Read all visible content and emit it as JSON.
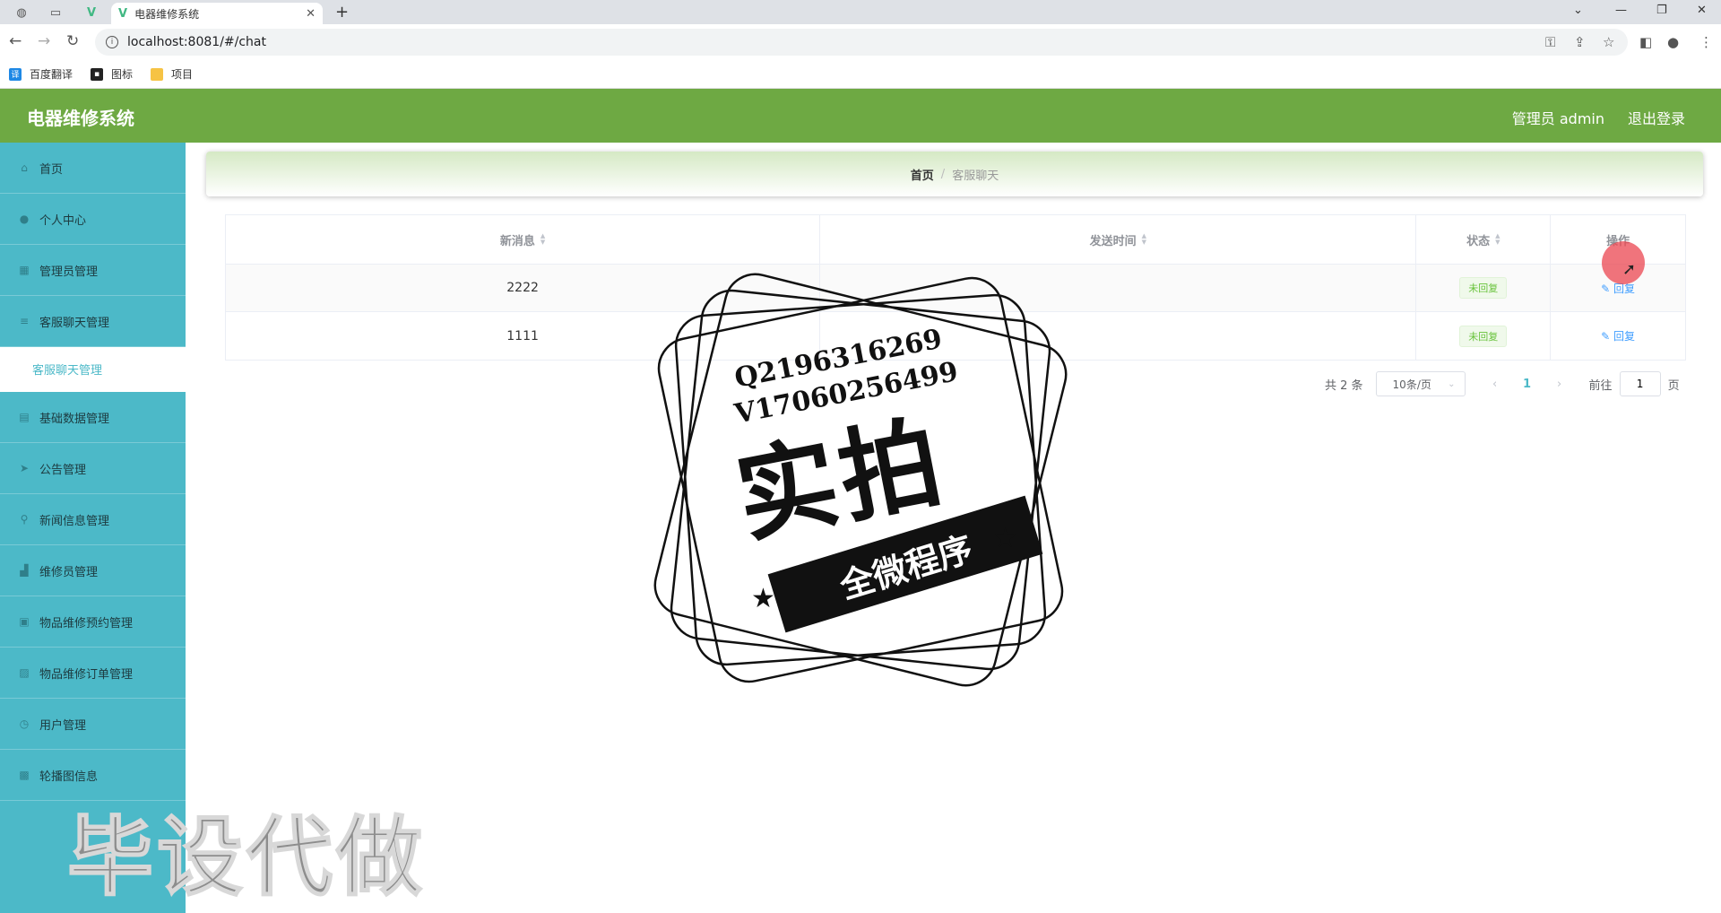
{
  "browser": {
    "tab_title": "电器维修系统",
    "url": "localhost:8081/#/chat",
    "bookmarks": [
      {
        "label": "百度翻译",
        "icon": "translate-icon"
      },
      {
        "label": "图标",
        "icon": "image-icon"
      },
      {
        "label": "项目",
        "icon": "folder-icon"
      }
    ]
  },
  "header": {
    "title": "电器维修系统",
    "user": "管理员 admin",
    "logout": "退出登录",
    "color": "#6ea943"
  },
  "sidebar": {
    "color": "#4cb9c8",
    "items": [
      {
        "label": "首页",
        "icon": "home-icon"
      },
      {
        "label": "个人中心",
        "icon": "user-icon"
      },
      {
        "label": "管理员管理",
        "icon": "admin-icon"
      },
      {
        "label": "客服聊天管理",
        "icon": "list-icon"
      },
      {
        "label": "客服聊天管理",
        "icon": "",
        "active": true
      },
      {
        "label": "基础数据管理",
        "icon": "database-icon"
      },
      {
        "label": "公告管理",
        "icon": "send-icon"
      },
      {
        "label": "新闻信息管理",
        "icon": "pin-icon"
      },
      {
        "label": "维修员管理",
        "icon": "chart-icon"
      },
      {
        "label": "物品维修预约管理",
        "icon": "cart-icon"
      },
      {
        "label": "物品维修订单管理",
        "icon": "picture-icon"
      },
      {
        "label": "用户管理",
        "icon": "clock-icon"
      },
      {
        "label": "轮播图信息",
        "icon": "image-icon"
      }
    ]
  },
  "breadcrumb": {
    "home": "首页",
    "separator": "/",
    "current": "客服聊天"
  },
  "table": {
    "columns": [
      "新消息",
      "发送时间",
      "状态",
      "操作"
    ],
    "rows": [
      {
        "message": "2222",
        "time": "",
        "status": "未回复",
        "action": "回复"
      },
      {
        "message": "1111",
        "time": "",
        "status": "未回复",
        "action": "回复"
      }
    ]
  },
  "pagination": {
    "total": "共 2 条",
    "page_size": "10条/页",
    "current_page": "1",
    "goto_label": "前往",
    "goto_value": "1",
    "page_suffix": "页"
  },
  "watermark": {
    "line1": "Q2196316269",
    "line2": "V17060256499",
    "big": "实拍",
    "banner": "全微程序",
    "bottom": "毕设代做"
  }
}
